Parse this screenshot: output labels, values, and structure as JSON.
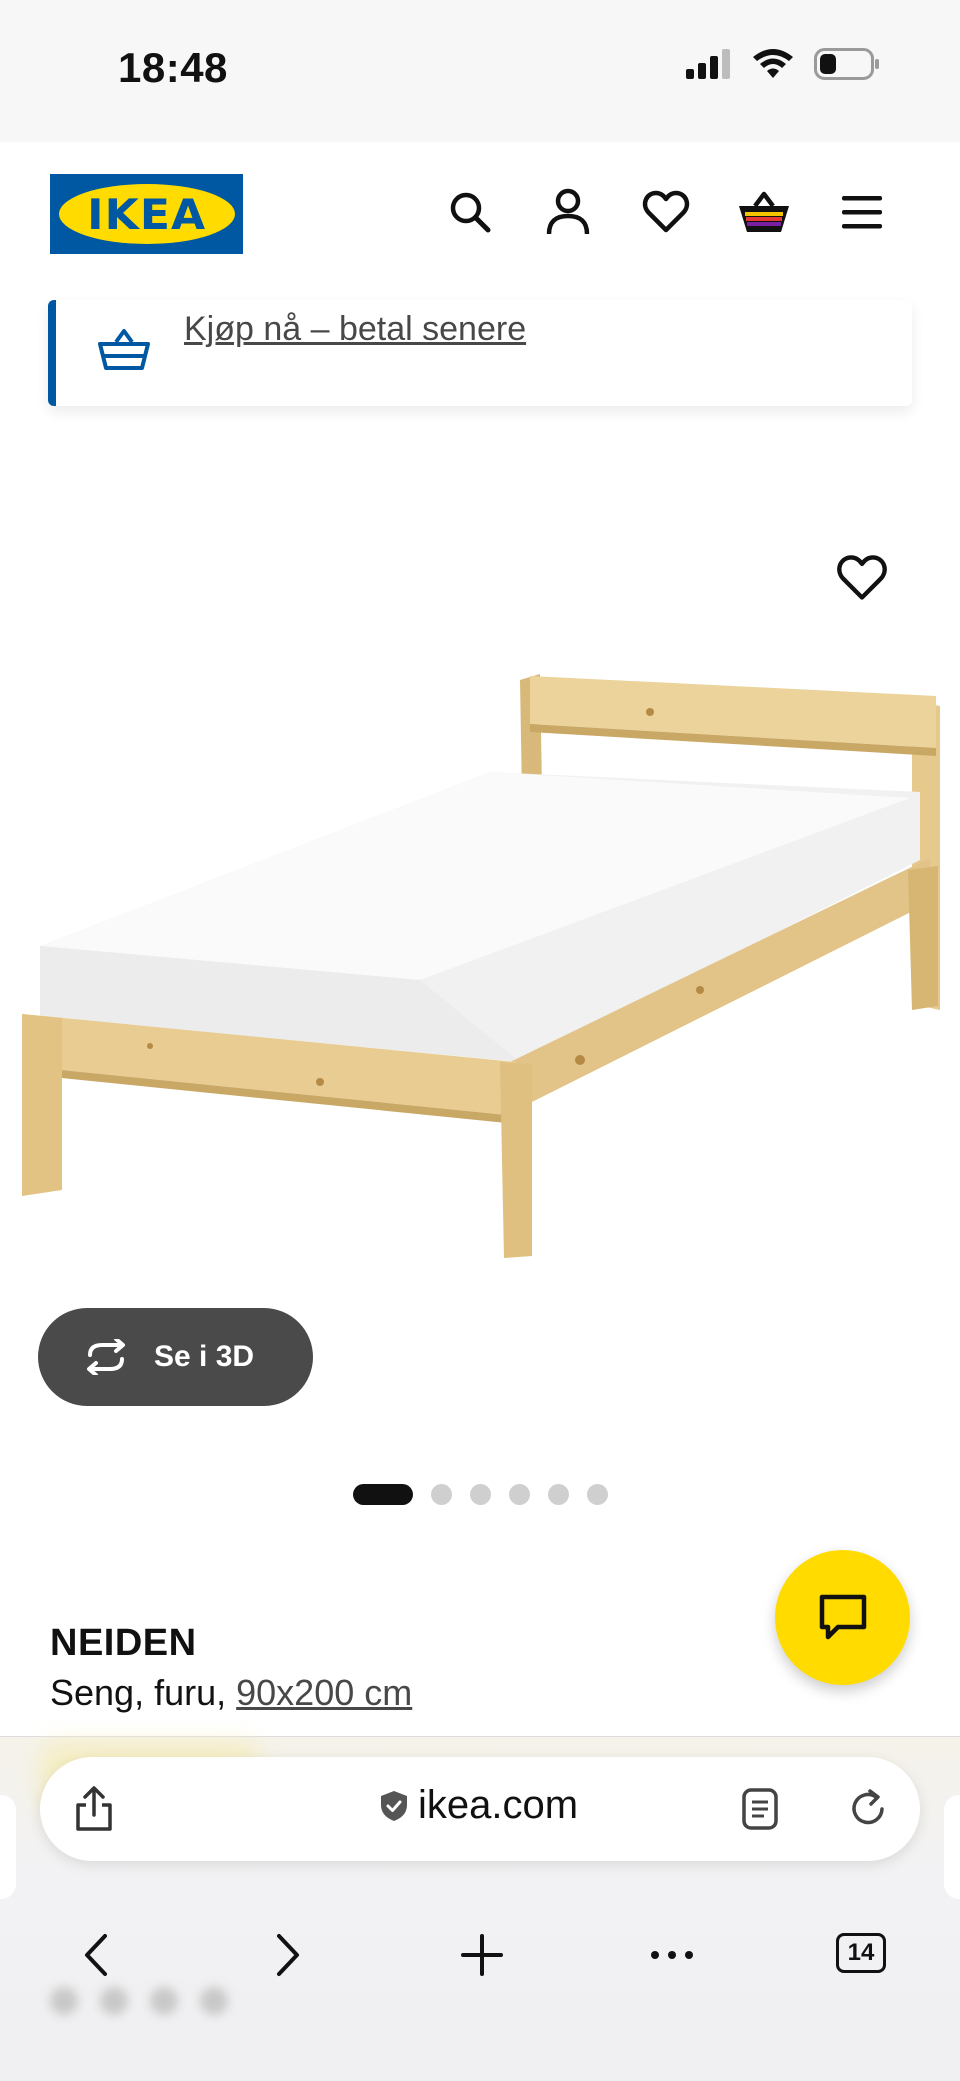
{
  "status_bar": {
    "time": "18:48",
    "icons": [
      "cellular-signal-icon",
      "wifi-icon",
      "battery-icon"
    ]
  },
  "header": {
    "logo_text": "IKEA",
    "icons": [
      "search-icon",
      "user-icon",
      "heart-icon",
      "cart-icon",
      "menu-icon"
    ]
  },
  "banner": {
    "link_text": "Kjøp nå – betal senere",
    "icon": "basket-icon"
  },
  "product": {
    "see_3d_label": "Se i 3D",
    "gallery_total": 6,
    "gallery_active": 1,
    "name": "NEIDEN",
    "description": "Seng, furu,",
    "size": "90x200 cm"
  },
  "browser": {
    "url": "ikea.com",
    "tab_count": "14"
  },
  "colors": {
    "ikea_blue": "#0058a3",
    "ikea_yellow": "#ffdb00",
    "text": "#111111",
    "link_grey": "#484848"
  }
}
